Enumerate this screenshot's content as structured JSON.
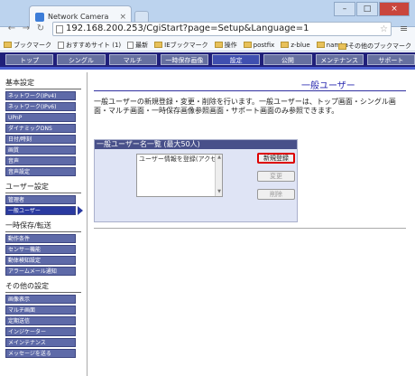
{
  "browser": {
    "tab_title": "Network Camera",
    "url": "192.168.200.253/CgiStart?page=Setup&Language=1",
    "bookmarks": [
      {
        "label": "ブックマーク",
        "kind": "folder"
      },
      {
        "label": "おすすめサイト (1)",
        "kind": "page"
      },
      {
        "label": "最新",
        "kind": "page"
      },
      {
        "label": "IEブックマーク",
        "kind": "folder"
      },
      {
        "label": "操作",
        "kind": "folder"
      },
      {
        "label": "postfix",
        "kind": "folder"
      },
      {
        "label": "z-blue",
        "kind": "folder"
      },
      {
        "label": "namba",
        "kind": "folder"
      }
    ],
    "bookmarks_other": "その他のブックマーク"
  },
  "nav": {
    "tabs": [
      "トップ",
      "シングル",
      "マルチ",
      "一時保存画像",
      "設定",
      "公開",
      "メンテナンス",
      "サポート"
    ],
    "active_index": 4
  },
  "sidebar": {
    "groups": [
      {
        "heading": "基本設定",
        "items": [
          "ネットワーク(IPv4)",
          "ネットワーク(IPv6)",
          "UPnP",
          "ダイナミックDNS",
          "日付/時刻",
          "画質",
          "音声",
          "音声設定"
        ]
      },
      {
        "heading": "ユーザー設定",
        "items": [
          "管理者",
          "一般ユーザー"
        ],
        "active_item": "一般ユーザー"
      },
      {
        "heading": "一時保存/転送",
        "items": [
          "動作条件",
          "センサー機能",
          "動体検知設定",
          "アラームメール通知"
        ]
      },
      {
        "heading": "その他の設定",
        "items": [
          "画像表示",
          "マルチ画面",
          "定期送信",
          "インジケーター",
          "メインテナンス",
          "メッセージを送る"
        ]
      }
    ]
  },
  "main": {
    "title": "一般ユーザー",
    "description": "一般ユーザーの新規登録・変更・削除を行います。一般ユーザーは、トップ画面・シングル画面・マルチ画面・一時保存画像参照画面・サポート画面のみ参照できます。",
    "panel_title": "一般ユーザー名一覧 (最大50人)",
    "list_options": [
      "ユーザー情報を登録(アクセス)"
    ],
    "buttons": {
      "new": "新規登録",
      "edit": "変更",
      "delete": "削除"
    }
  }
}
